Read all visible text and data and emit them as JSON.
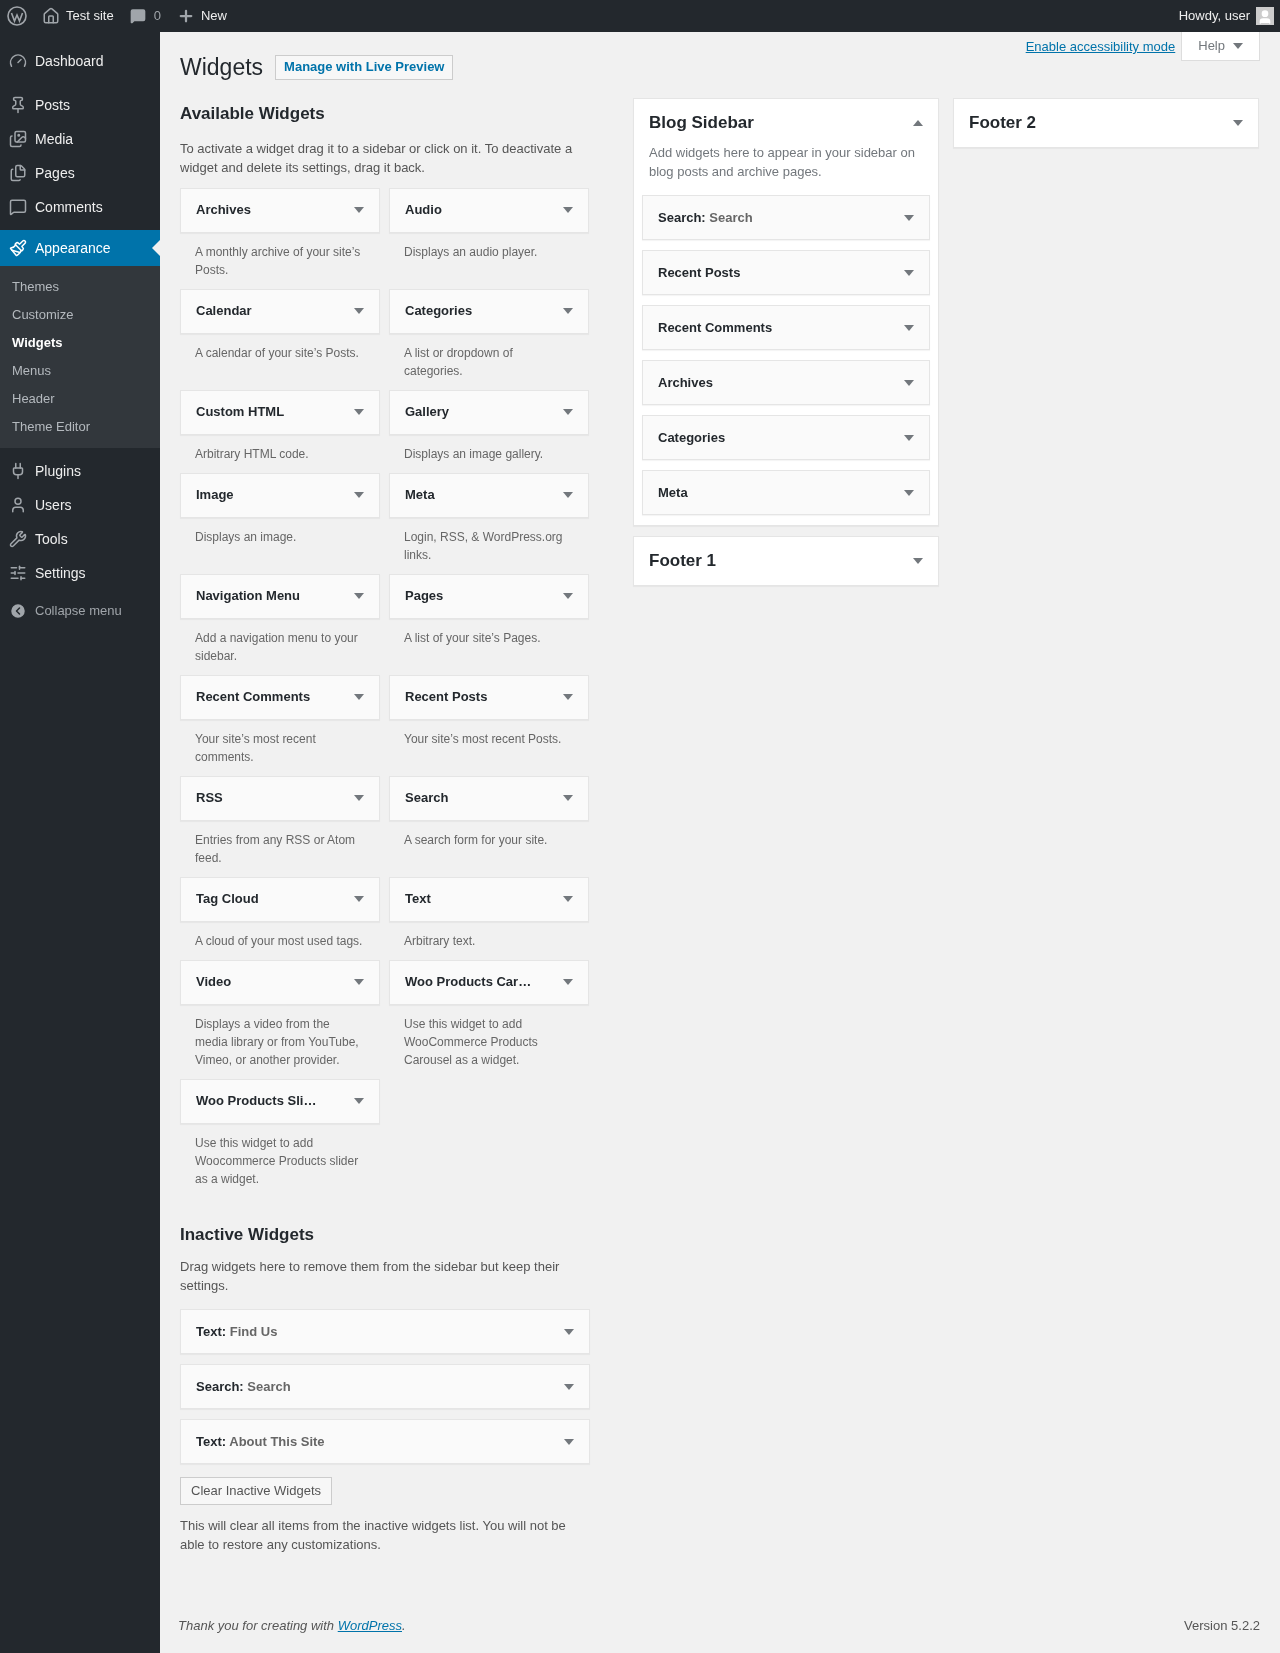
{
  "admin_bar": {
    "site": "Test site",
    "comments": "0",
    "new": "New",
    "greeting": "Howdy, user"
  },
  "menu": [
    {
      "kind": "item",
      "label": "Dashboard",
      "selected": false
    },
    {
      "kind": "item",
      "label": "Posts",
      "selected": false
    },
    {
      "kind": "item",
      "label": "Media",
      "selected": false
    },
    {
      "kind": "item",
      "label": "Pages",
      "selected": false
    },
    {
      "kind": "item",
      "label": "Comments",
      "selected": false
    },
    {
      "kind": "item",
      "label": "Appearance",
      "selected": true,
      "children": [
        {
          "label": "Themes",
          "selected": false
        },
        {
          "label": "Customize",
          "selected": false
        },
        {
          "label": "Widgets",
          "selected": true
        },
        {
          "label": "Menus",
          "selected": false
        },
        {
          "label": "Header",
          "selected": false
        },
        {
          "label": "Theme Editor",
          "selected": false
        }
      ]
    },
    {
      "kind": "item",
      "label": "Plugins",
      "selected": false
    },
    {
      "kind": "item",
      "label": "Users",
      "selected": false
    },
    {
      "kind": "item",
      "label": "Tools",
      "selected": false
    },
    {
      "kind": "item",
      "label": "Settings",
      "selected": false
    },
    {
      "kind": "collapse",
      "label": "Collapse menu"
    }
  ],
  "screen_meta": {
    "accessibility_link": "Enable accessibility mode",
    "help": "Help"
  },
  "title": "Widgets",
  "live_preview": "Manage with Live Preview",
  "available": {
    "heading": "Available Widgets",
    "description": "To activate a widget drag it to a sidebar or click on it. To deactivate a widget and delete its settings, drag it back.",
    "widgets": [
      {
        "name": "Archives",
        "description": "A monthly archive of your site’s Posts."
      },
      {
        "name": "Audio",
        "description": "Displays an audio player."
      },
      {
        "name": "Calendar",
        "description": "A calendar of your site’s Posts."
      },
      {
        "name": "Categories",
        "description": "A list or dropdown of categories."
      },
      {
        "name": "Custom HTML",
        "description": "Arbitrary HTML code."
      },
      {
        "name": "Gallery",
        "description": "Displays an image gallery."
      },
      {
        "name": "Image",
        "description": "Displays an image."
      },
      {
        "name": "Meta",
        "description": "Login, RSS, & WordPress.org links."
      },
      {
        "name": "Navigation Menu",
        "description": "Add a navigation menu to your sidebar."
      },
      {
        "name": "Pages",
        "description": "A list of your site’s Pages."
      },
      {
        "name": "Recent Comments",
        "description": "Your site’s most recent comments."
      },
      {
        "name": "Recent Posts",
        "description": "Your site’s most recent Posts."
      },
      {
        "name": "RSS",
        "description": "Entries from any RSS or Atom feed."
      },
      {
        "name": "Search",
        "description": "A search form for your site."
      },
      {
        "name": "Tag Cloud",
        "description": "A cloud of your most used tags."
      },
      {
        "name": "Text",
        "description": "Arbitrary text."
      },
      {
        "name": "Video",
        "description": "Displays a video from the media library or from YouTube, Vimeo, or another provider."
      },
      {
        "name": "Woo Products Car…",
        "description": "Use this widget to add WooCommerce Products Carousel as a widget."
      },
      {
        "name": "Woo Products Sli…",
        "description": "Use this widget to add Woocommerce Products slider as a widget."
      }
    ]
  },
  "inactive": {
    "heading": "Inactive Widgets",
    "description": "Drag widgets here to remove them from the sidebar but keep their settings.",
    "widgets": [
      {
        "name": "Text:",
        "title": "Find Us"
      },
      {
        "name": "Search:",
        "title": "Search"
      },
      {
        "name": "Text:",
        "title": "About This Site"
      }
    ],
    "clear_button": "Clear Inactive Widgets",
    "note": "This will clear all items from the inactive widgets list. You will not be able to restore any customizations."
  },
  "sidebar_columns": [
    [
      {
        "title": "Blog Sidebar",
        "expanded": true,
        "description": "Add widgets here to appear in your sidebar on blog posts and archive pages.",
        "widgets": [
          {
            "name": "Search:",
            "title": "Search"
          },
          {
            "name": "Recent Posts"
          },
          {
            "name": "Recent Comments"
          },
          {
            "name": "Archives"
          },
          {
            "name": "Categories"
          },
          {
            "name": "Meta"
          }
        ]
      },
      {
        "title": "Footer 1",
        "expanded": false
      }
    ],
    [
      {
        "title": "Footer 2",
        "expanded": false
      }
    ]
  ],
  "footer": {
    "thanks_before": "Thank you for creating with ",
    "thanks_link": "WordPress",
    "thanks_after": ".",
    "version": "Version 5.2.2"
  }
}
